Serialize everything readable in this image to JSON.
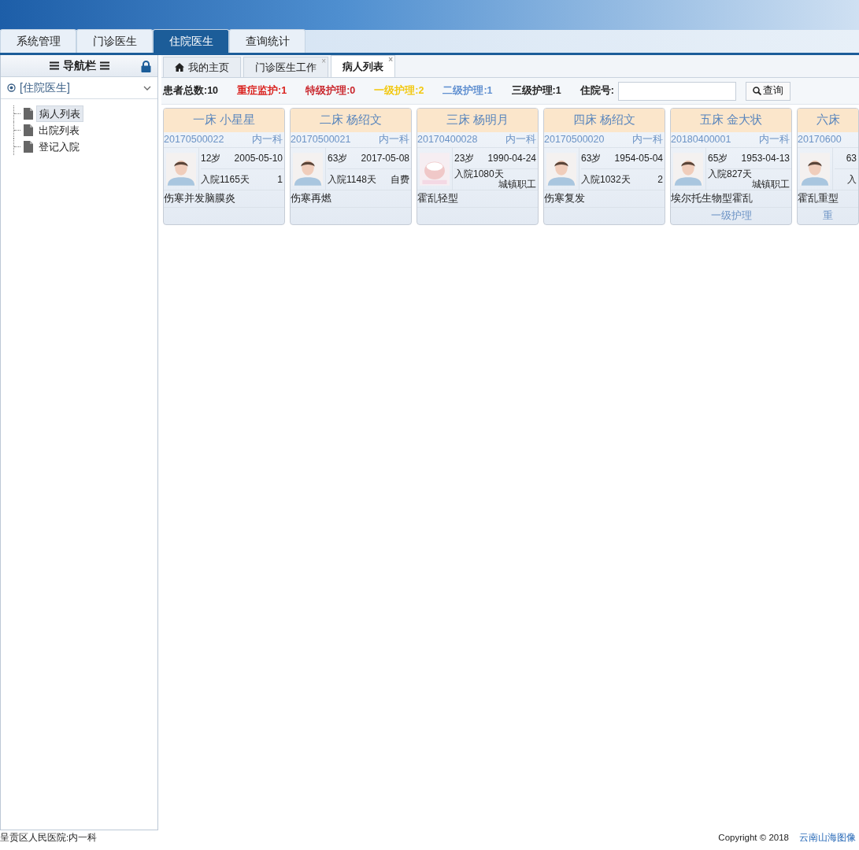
{
  "top_tabs": [
    {
      "label": "系统管理",
      "selected": false
    },
    {
      "label": "门诊医生",
      "selected": false
    },
    {
      "label": "住院医生",
      "selected": true
    },
    {
      "label": "查询统计",
      "selected": false
    }
  ],
  "sidebar": {
    "title": "导航栏",
    "section": "[住院医生]",
    "items": [
      {
        "label": "病人列表",
        "selected": true
      },
      {
        "label": "出院列表",
        "selected": false
      },
      {
        "label": "登记入院",
        "selected": false
      }
    ]
  },
  "page_tabs": [
    {
      "label": "我的主页",
      "kind": "home",
      "selected": false
    },
    {
      "label": "门诊医生工作",
      "kind": "closable",
      "close": "×",
      "selected": false
    },
    {
      "label": "病人列表",
      "kind": "closable",
      "close": "×",
      "selected": true
    }
  ],
  "stats": [
    {
      "text": "患者总数:10",
      "color": "#222222"
    },
    {
      "text": "重症监护:1",
      "color": "#d9201c"
    },
    {
      "text": "特级护理:0",
      "color": "#c9262c"
    },
    {
      "text": "一级护理:2",
      "color": "#f2c80f"
    },
    {
      "text": "二级护理:1",
      "color": "#5f8fd0"
    },
    {
      "text": "三级护理:1",
      "color": "#222222"
    }
  ],
  "search": {
    "label": "住院号:",
    "button": "查询"
  },
  "patients": [
    {
      "title": "一床 小星星",
      "id": "20170500022",
      "dept": "内一科",
      "kind": "adult",
      "age": "12岁",
      "birth": "2005-05-10",
      "days": "入院1165天",
      "payer": "1",
      "diagnosis": "伤寒并发脑膜炎"
    },
    {
      "title": "二床 杨绍文",
      "id": "20170500021",
      "dept": "内一科",
      "kind": "adult",
      "age": "63岁",
      "birth": "2017-05-08",
      "days": "入院1148天",
      "payer": "自费",
      "diagnosis": "伤寒再燃"
    },
    {
      "title": "三床 杨明月",
      "id": "20170400028",
      "dept": "内一科",
      "kind": "baby",
      "age": "23岁",
      "birth": "1990-04-24",
      "days": "入院1080天",
      "payer": "城镇职工",
      "diagnosis": "霍乱轻型"
    },
    {
      "title": "四床 杨绍文",
      "id": "20170500020",
      "dept": "内一科",
      "kind": "adult",
      "age": "63岁",
      "birth": "1954-05-04",
      "days": "入院1032天",
      "payer": "2",
      "diagnosis": "伤寒复发"
    },
    {
      "title": "五床 金大状",
      "id": "20180400001",
      "dept": "内一科",
      "kind": "adult",
      "age": "65岁",
      "birth": "1953-04-13",
      "days": "入院827天",
      "payer": "城镇职工",
      "diagnosis": "埃尔托生物型霍乱",
      "nursing": "一级护理"
    },
    {
      "title": "六床",
      "id": "20170600",
      "kind": "adult",
      "age": "63",
      "days": "入",
      "diagnosis": "霍乱重型",
      "nursing": "重"
    }
  ],
  "footer": {
    "left": "呈贡区人民医院:内一科",
    "copyright": "Copyright © 2018",
    "link": "云南山海图像"
  }
}
